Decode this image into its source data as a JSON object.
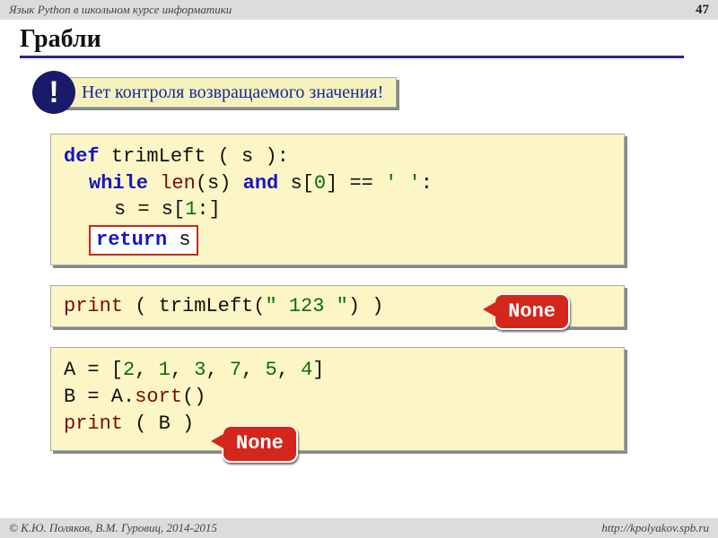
{
  "header": {
    "course": "Язык Python в школьном курсе информатики",
    "page": "47"
  },
  "title": "Грабли",
  "warning": {
    "bang": "!",
    "text": "Нет контроля возвращаемого значения!"
  },
  "code1": {
    "kw_def": "def",
    "fn_name": "trimLeft",
    "params": " ( s ):",
    "kw_while": "while",
    "fn_len": "len",
    "len_arg": "(s) ",
    "kw_and": "and",
    "idx_open": " s[",
    "idx0": "0",
    "idx_close_eq": "] == ",
    "str_space": "' '",
    "colon": ":",
    "assign_pre": "s = s[",
    "idx1": "1",
    "assign_post": ":]",
    "kw_return": "return",
    "ret_var": " s"
  },
  "code2": {
    "fn_print": "print",
    "open": " ( trimLeft(",
    "str": "\"   123   \"",
    "close": ") )",
    "badge": "None"
  },
  "code3": {
    "line1_pre": "A = [",
    "a0": "2",
    "c": ", ",
    "a1": "1",
    "a2": "3",
    "a3": "7",
    "a4": "5",
    "a5": "4",
    "line1_post": "]",
    "line2_pre": "B = A",
    "dot": ".",
    "fn_sort": "sort",
    "line2_post": "()",
    "fn_print": "print",
    "line3_args": " ( B )",
    "badge": "None"
  },
  "footer": {
    "copyright": "© К.Ю. Поляков, В.М. Гуровиц, 2014-2015",
    "url": "http://kpolyakov.spb.ru"
  }
}
